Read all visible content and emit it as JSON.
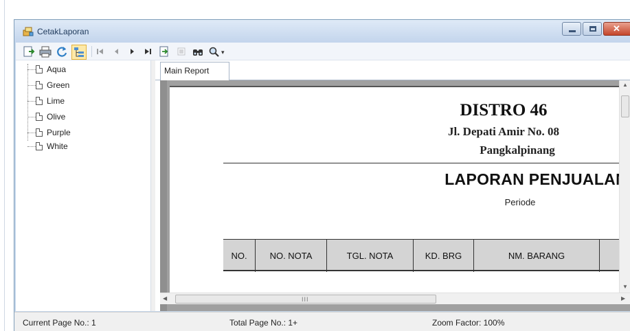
{
  "window": {
    "title": "CetakLaporan"
  },
  "toolbar": {
    "buttons": [
      "export-icon",
      "print-icon",
      "refresh-icon",
      "toggle-tree-icon",
      "first-page-icon",
      "previous-page-icon",
      "next-page-icon",
      "last-page-icon",
      "goto-page-icon",
      "stop-icon",
      "search-icon",
      "zoom-icon"
    ]
  },
  "tree": {
    "items": [
      {
        "label": "Aqua"
      },
      {
        "label": "Green"
      },
      {
        "label": "Lime"
      },
      {
        "label": "Olive"
      },
      {
        "label": "Purple"
      },
      {
        "label": "White"
      }
    ]
  },
  "tabs": [
    {
      "label": "Main Report"
    }
  ],
  "report": {
    "company": "DISTRO 46",
    "address": "Jl. Depati Amir No. 08",
    "city": "Pangkalpinang",
    "title": "LAPORAN PENJUALAN",
    "subtitle": "Periode",
    "columns": [
      "NO.",
      "NO. NOTA",
      "TGL. NOTA",
      "KD. BRG",
      "NM. BARANG",
      ""
    ]
  },
  "scrollbar": {
    "grip": "III"
  },
  "status": {
    "current_page": "Current Page No.: 1",
    "total_pages": "Total Page No.: 1+",
    "zoom": "Zoom Factor: 100%"
  },
  "colors": {
    "titlebar": "#c3d5ec",
    "close_button": "#c4452a",
    "table_header": "#d4d4d4"
  }
}
